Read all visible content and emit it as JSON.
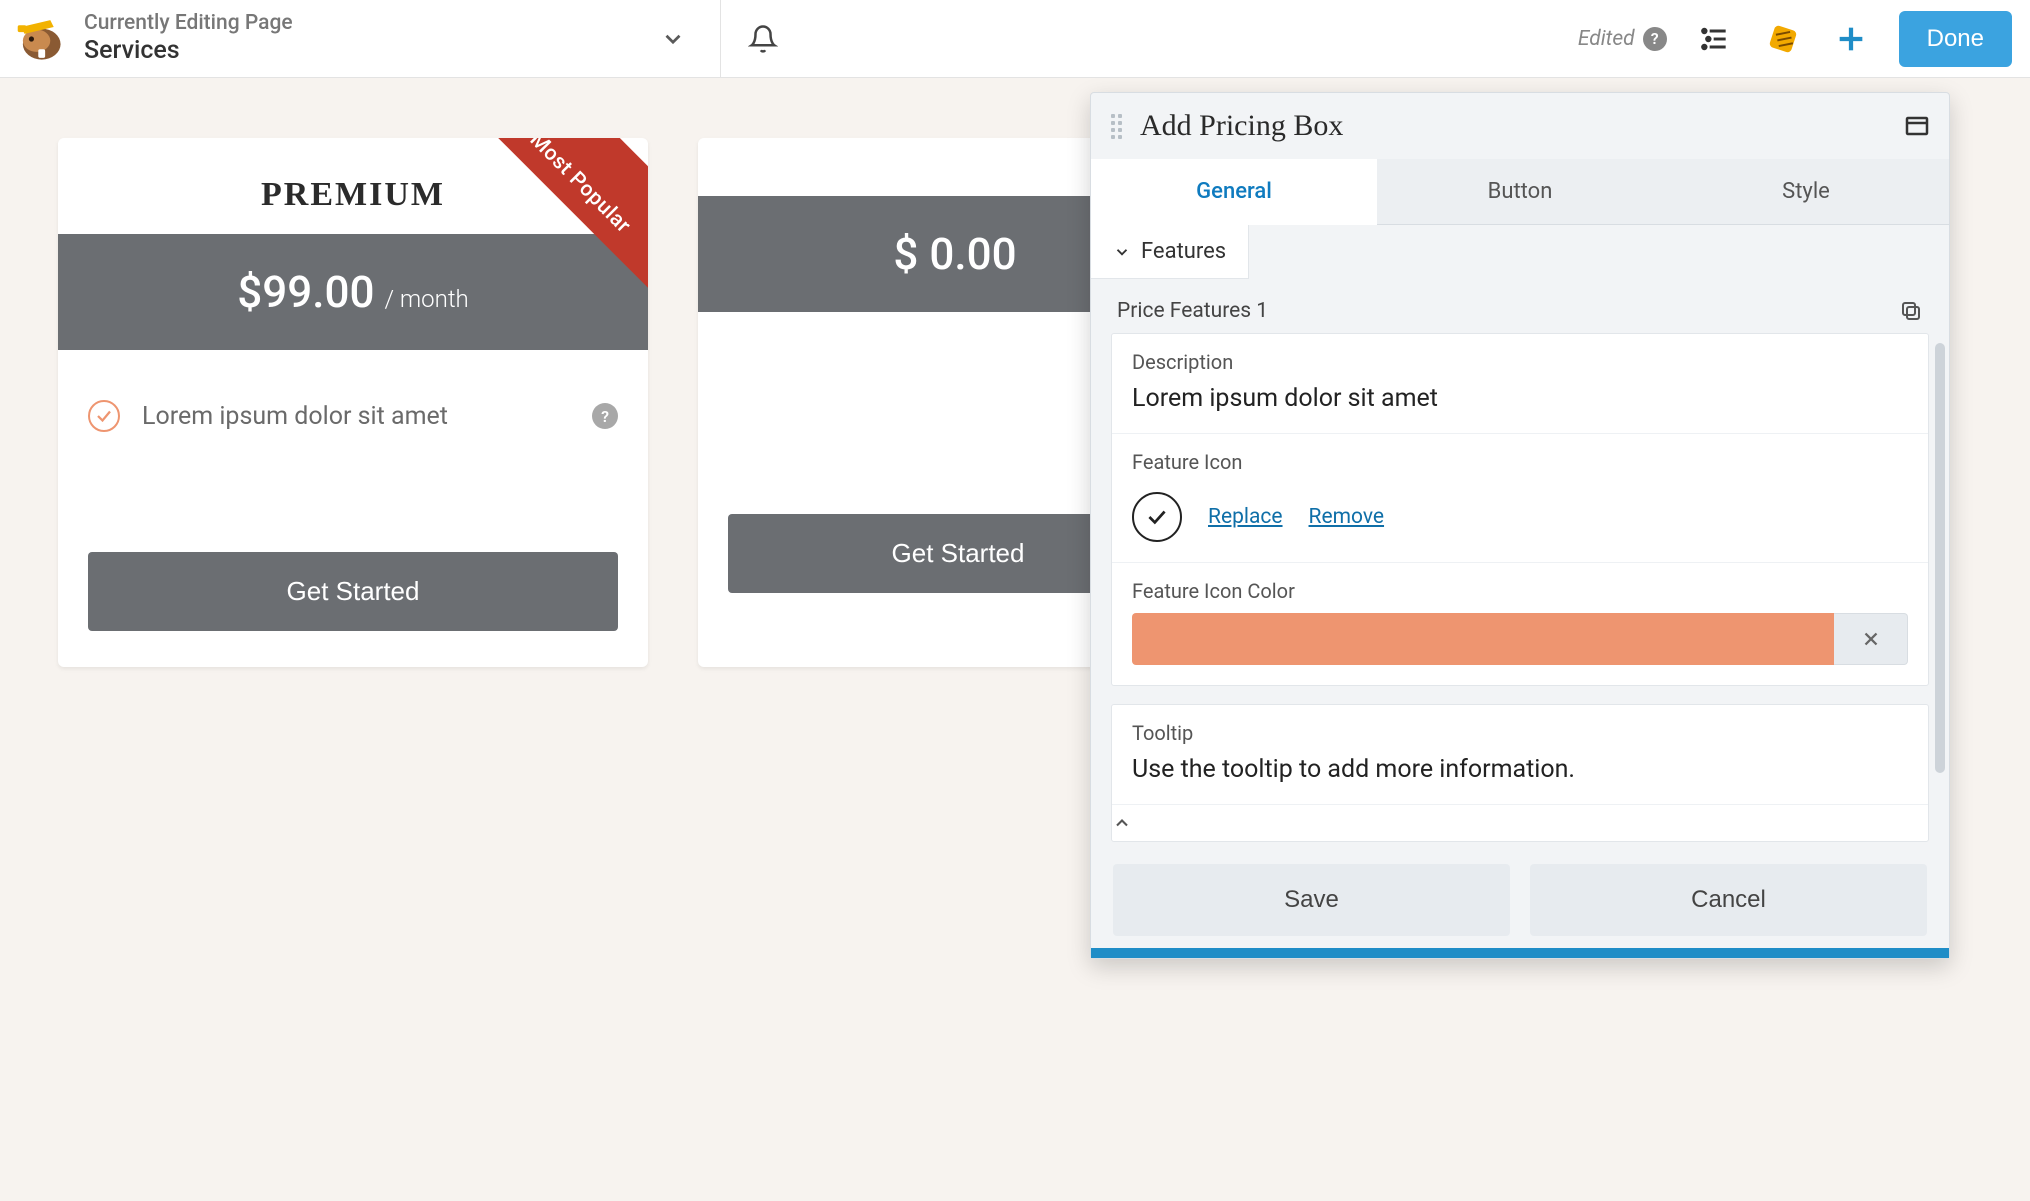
{
  "topbar": {
    "editing_label": "Currently Editing Page",
    "page_title": "Services",
    "edited_label": "Edited",
    "done_label": "Done"
  },
  "cards": [
    {
      "title": "PREMIUM",
      "ribbon": "Most Popular",
      "price": "$99.00",
      "period": "/ month",
      "feature": "Lorem ipsum dolor sit amet",
      "cta": "Get Started"
    },
    {
      "title": "",
      "price": "$ 0.00",
      "period": "",
      "cta": "Get Started"
    }
  ],
  "panel": {
    "title": "Add Pricing Box",
    "tabs": {
      "general": "General",
      "button": "Button",
      "style": "Style"
    },
    "section": "Features",
    "group_title": "Price Features 1",
    "fields": {
      "description_label": "Description",
      "description_value": "Lorem ipsum dolor sit amet",
      "icon_label": "Feature Icon",
      "replace": "Replace",
      "remove": "Remove",
      "icon_color_label": "Feature Icon Color",
      "icon_color": "#ee9570",
      "tooltip_label": "Tooltip",
      "tooltip_value": "Use the tooltip to add more information."
    },
    "footer": {
      "save": "Save",
      "cancel": "Cancel"
    }
  }
}
